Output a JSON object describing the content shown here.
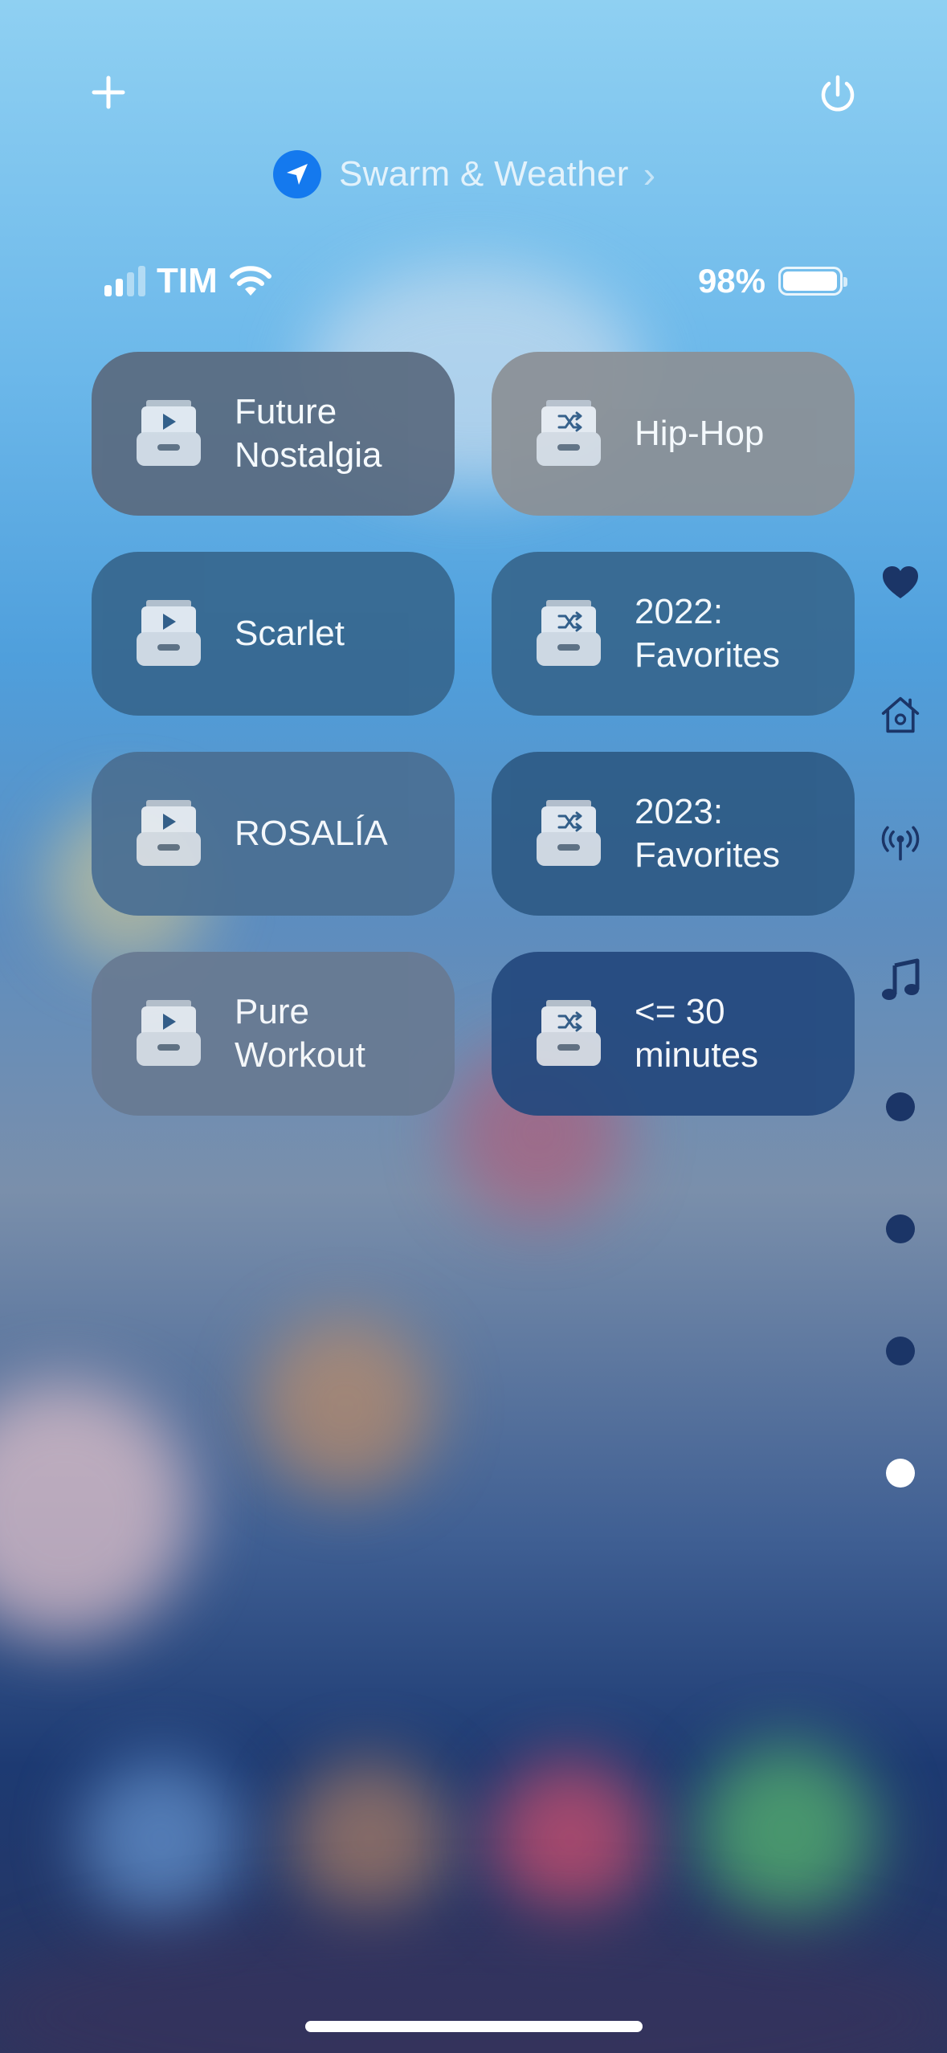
{
  "header": {
    "add_icon": "plus-icon",
    "power_icon": "power-icon",
    "focus_label": "Swarm & Weather",
    "focus_icon": "location-arrow-icon",
    "chevron": "›"
  },
  "status_bar": {
    "carrier": "TIM",
    "signal_bars_active": 2,
    "signal_bars_total": 4,
    "battery_percent": "98%",
    "battery_level": 0.98
  },
  "shortcuts": [
    {
      "label": "Future\nNostalgia",
      "icon": "playlist-play-icon",
      "tint": "#5a6b80"
    },
    {
      "label": "Hip-Hop",
      "icon": "playlist-shuffle-icon",
      "tint": "#8b9096"
    },
    {
      "label": "Scarlet",
      "icon": "playlist-play-icon",
      "tint": "#37678f"
    },
    {
      "label": "2022:\nFavorites",
      "icon": "playlist-shuffle-icon",
      "tint": "#37678f"
    },
    {
      "label": "ROSALÍA",
      "icon": "playlist-play-icon",
      "tint": "#4a6f93"
    },
    {
      "label": "2023:\nFavorites",
      "icon": "playlist-shuffle-icon",
      "tint": "#2e5b86"
    },
    {
      "label": "Pure\nWorkout",
      "icon": "playlist-play-icon",
      "tint": "#687a92"
    },
    {
      "label": "<= 30\nminutes",
      "icon": "playlist-shuffle-icon",
      "tint": "#24497e"
    }
  ],
  "page_sidebar": {
    "icons": [
      "heart-icon",
      "home-icon",
      "antenna-icon",
      "music-note-icon"
    ],
    "page_count": 4,
    "active_page": 4
  },
  "colors": {
    "accent_blue": "#1479ee",
    "sidebar_icon": "#1b3567"
  }
}
